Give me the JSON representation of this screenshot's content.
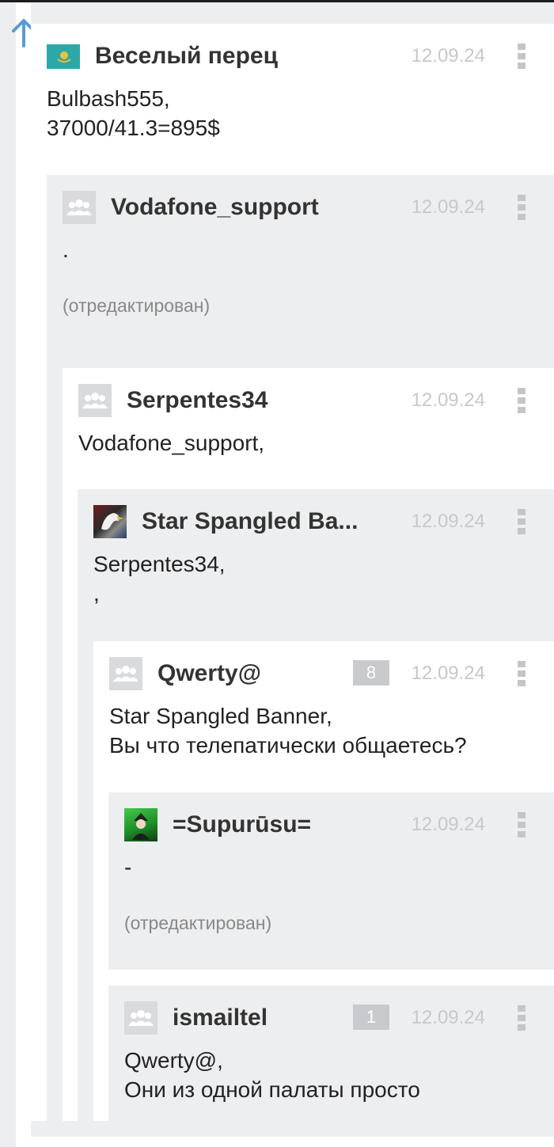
{
  "comments": [
    {
      "author": "Веселый перец",
      "date": "12.09.24",
      "text": "Bulbash555,\n37000/41.3=895$",
      "avatar_icon": "flag-avatar"
    },
    {
      "author": "Vodafone_support",
      "date": "12.09.24",
      "text": ".",
      "edited_label": "(отредактирован)",
      "avatar_icon": "users-icon"
    },
    {
      "author": "Serpentes34",
      "date": "12.09.24",
      "text": "Vodafone_support,",
      "avatar_icon": "users-icon"
    },
    {
      "author": "Star Spangled Ba...",
      "date": "12.09.24",
      "text": "Serpentes34,\n,",
      "avatar_icon": "eagle-avatar"
    },
    {
      "author": "Qwerty@",
      "date": "12.09.24",
      "rating": "8",
      "text": "Star Spangled Banner,\nВы что телепатически общаетесь?",
      "avatar_icon": "users-icon"
    },
    {
      "author": "=Supurūsu=",
      "date": "12.09.24",
      "text": "-",
      "edited_label": "(отредактирован)",
      "avatar_icon": "anime-avatar"
    },
    {
      "author": "ismailtel",
      "date": "12.09.24",
      "rating": "1",
      "text": "Qwerty@,\nОни из одной палаты просто",
      "avatar_icon": "users-icon"
    }
  ],
  "colors": {
    "accent": "#5a9bd5",
    "card_white": "#ffffff",
    "card_gray": "#edeef0",
    "muted": "#c8c8cb"
  }
}
